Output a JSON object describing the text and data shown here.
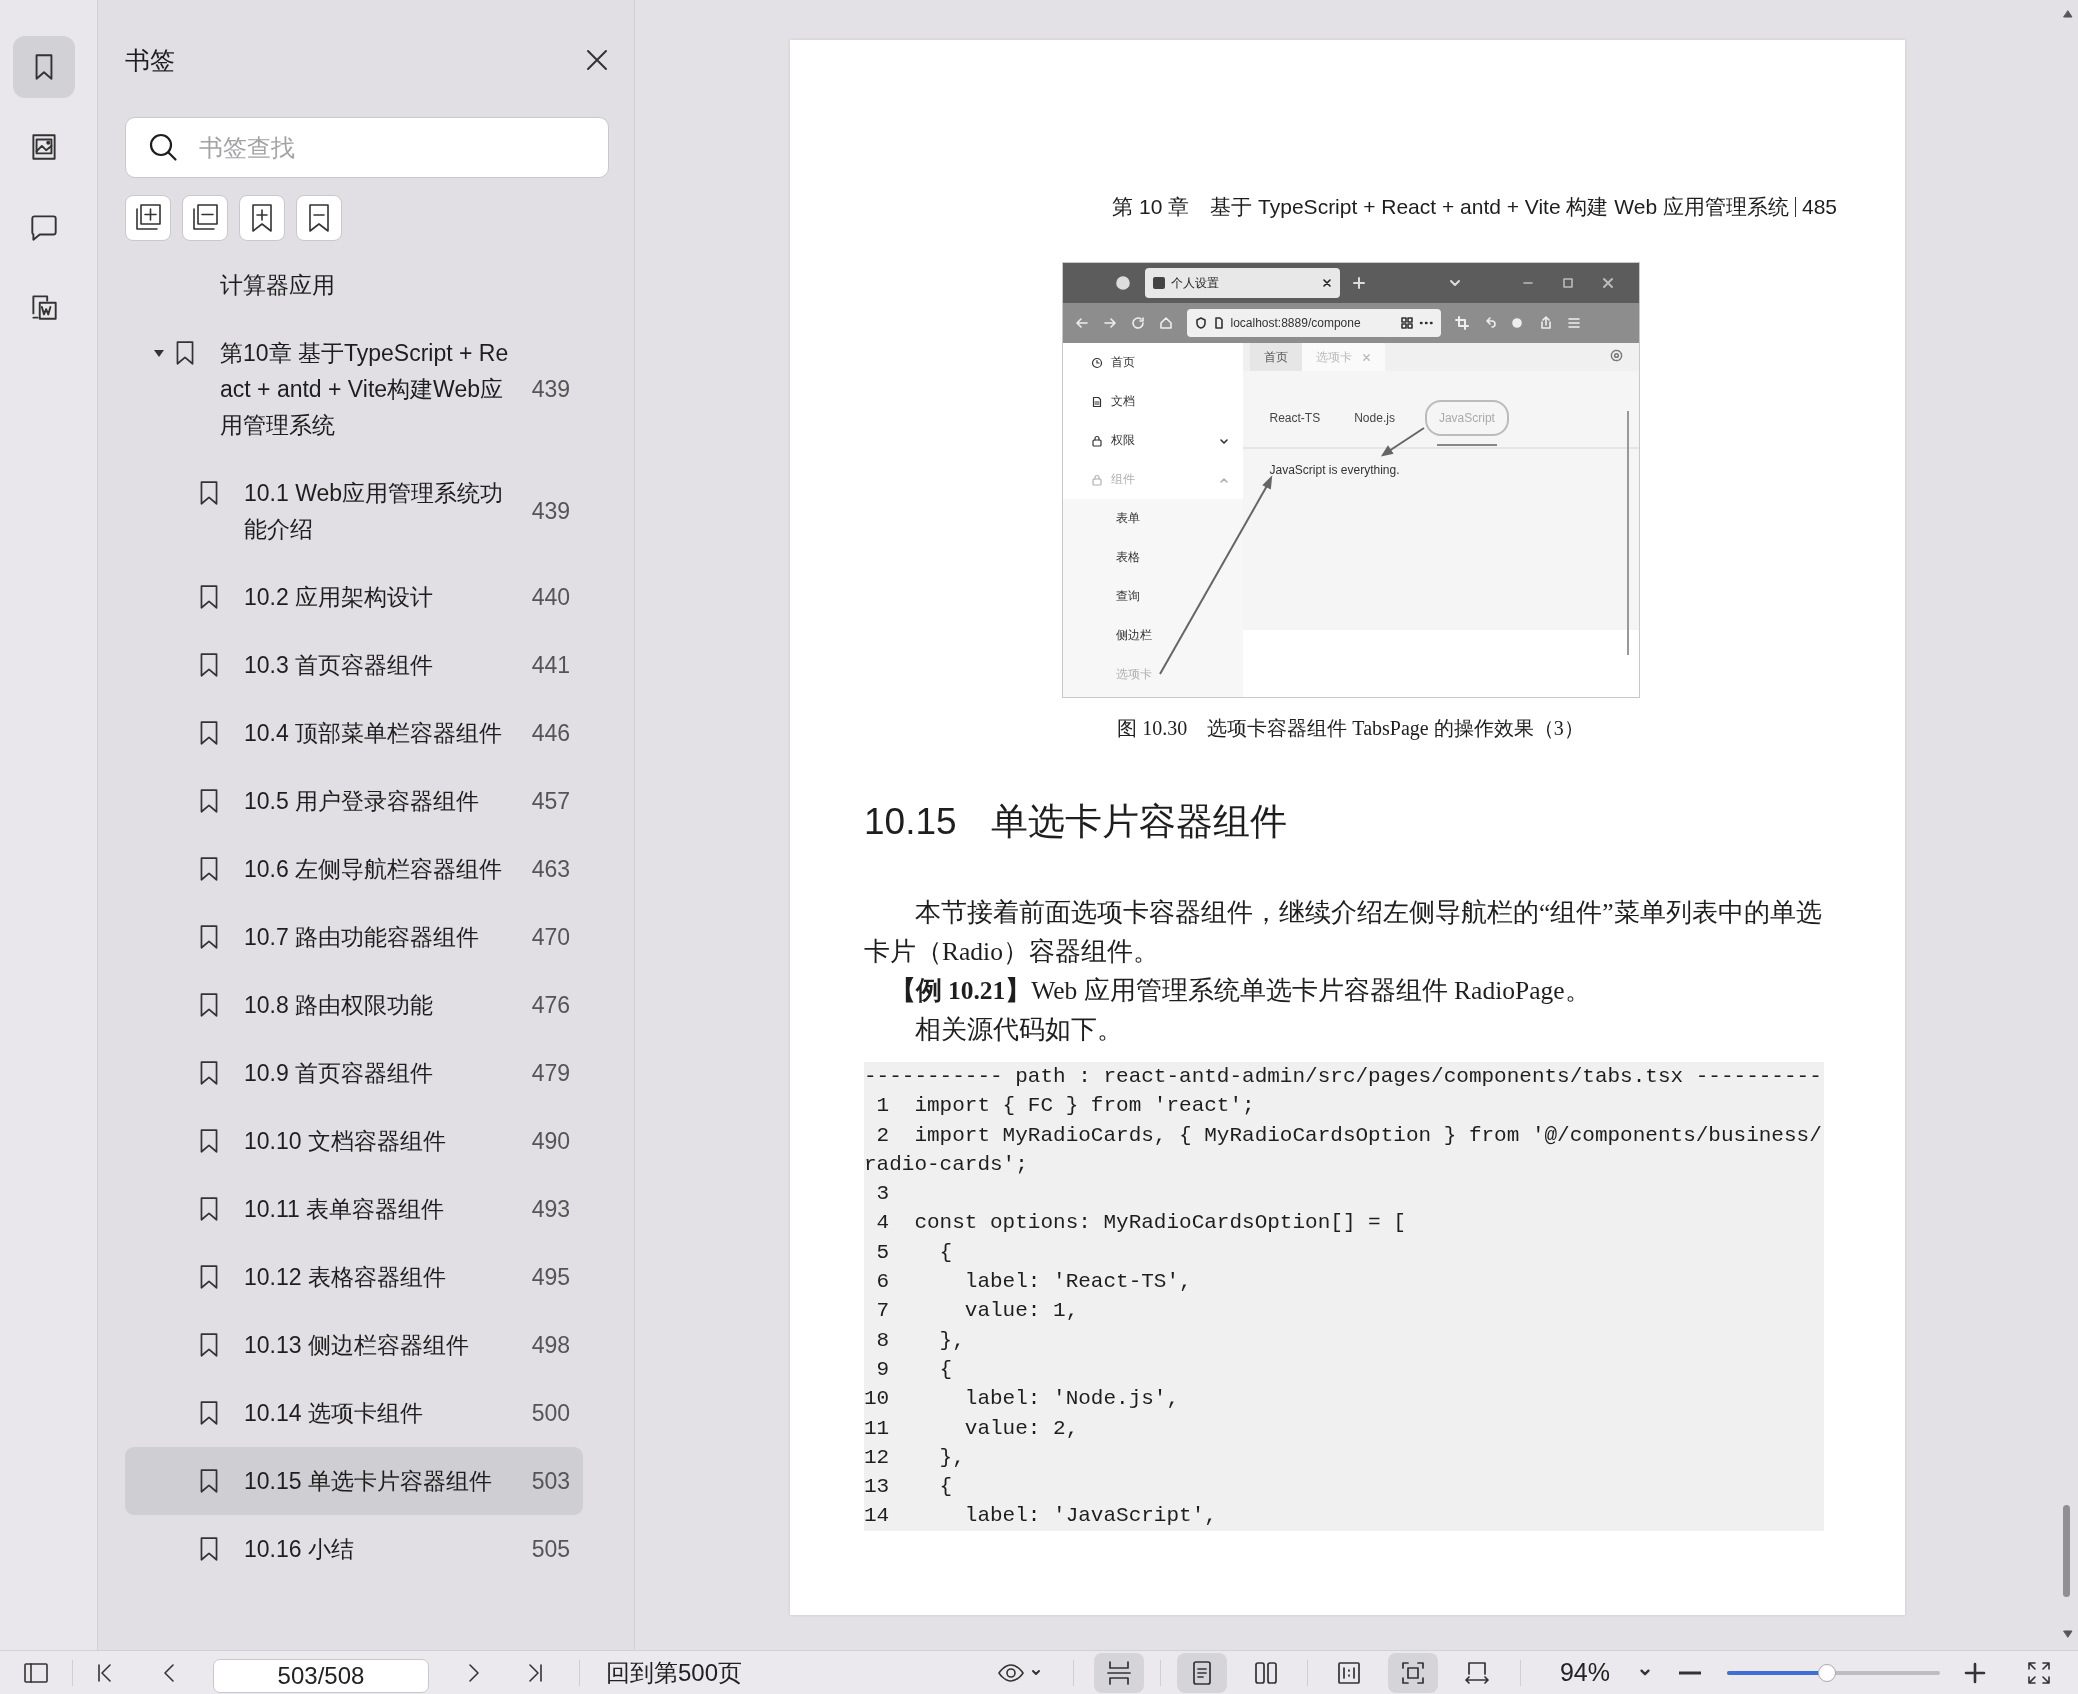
{
  "rail": [
    {
      "kind": "bookmarks",
      "selected": true
    },
    {
      "kind": "images",
      "selected": false
    },
    {
      "kind": "comments",
      "selected": false
    },
    {
      "kind": "convert",
      "selected": false
    }
  ],
  "bookmarks_panel": {
    "title": "书签",
    "search": {
      "placeholder": "书签查找"
    },
    "items": [
      {
        "kind": "fragment",
        "title": "计算器应用",
        "selected": false
      },
      {
        "kind": "item",
        "title": "第10章 基于TypeScript + React + antd + Vite构建Web应用管理系统",
        "page": "439",
        "selected": false,
        "expanded": true,
        "children": [
          {
            "kind": "item",
            "title": "10.1 Web应用管理系统功能介绍",
            "page": "439",
            "selected": false
          },
          {
            "kind": "item",
            "title": "10.2 应用架构设计",
            "page": "440",
            "selected": false
          },
          {
            "kind": "item",
            "title": "10.3 首页容器组件",
            "page": "441",
            "selected": false
          },
          {
            "kind": "item",
            "title": "10.4 顶部菜单栏容器组件",
            "page": "446",
            "selected": false
          },
          {
            "kind": "item",
            "title": "10.5 用户登录容器组件",
            "page": "457",
            "selected": false
          },
          {
            "kind": "item",
            "title": "10.6 左侧导航栏容器组件",
            "page": "463",
            "selected": false
          },
          {
            "kind": "item",
            "title": "10.7 路由功能容器组件",
            "page": "470",
            "selected": false
          },
          {
            "kind": "item",
            "title": "10.8 路由权限功能",
            "page": "476",
            "selected": false
          },
          {
            "kind": "item",
            "title": "10.9 首页容器组件",
            "page": "479",
            "selected": false
          },
          {
            "kind": "item",
            "title": "10.10 文档容器组件",
            "page": "490",
            "selected": false
          },
          {
            "kind": "item",
            "title": "10.11 表单容器组件",
            "page": "493",
            "selected": false
          },
          {
            "kind": "item",
            "title": "10.12 表格容器组件",
            "page": "495",
            "selected": false
          },
          {
            "kind": "item",
            "title": "10.13 侧边栏容器组件",
            "page": "498",
            "selected": false
          },
          {
            "kind": "item",
            "title": "10.14 选项卡组件",
            "page": "500",
            "selected": false
          },
          {
            "kind": "item",
            "title": "10.15 单选卡片容器组件",
            "page": "503",
            "selected": true
          },
          {
            "kind": "item",
            "title": "10.16 小结",
            "page": "505",
            "selected": false
          }
        ]
      }
    ]
  },
  "document": {
    "header": "第 10 章　基于 TypeScript + React + antd + Vite 构建 Web 应用管理系统",
    "page_number": "485",
    "figure": {
      "tab_title": "个人设置",
      "url": "localhost:8889/compone",
      "menu": [
        {
          "label": "首页",
          "kind": "item",
          "selected": false
        },
        {
          "label": "文档",
          "kind": "item",
          "selected": false
        },
        {
          "label": "权限",
          "kind": "group",
          "expanded": false,
          "selected": false
        },
        {
          "label": "组件",
          "kind": "group",
          "expanded": true,
          "selected": true
        }
      ],
      "submenu": [
        {
          "label": "表单",
          "selected": false
        },
        {
          "label": "表格",
          "selected": false
        },
        {
          "label": "查询",
          "selected": false
        },
        {
          "label": "侧边栏",
          "selected": false
        },
        {
          "label": "选项卡",
          "selected": true
        }
      ],
      "page_tabs": [
        {
          "label": "首页",
          "selected": false
        },
        {
          "label": "选项卡",
          "selected": true
        }
      ],
      "radio_tabs": [
        {
          "label": "React-TS",
          "selected": false
        },
        {
          "label": "Node.js",
          "selected": false
        },
        {
          "label": "JavaScript",
          "selected": true
        }
      ],
      "content": "JavaScript is everything."
    },
    "caption": "图 10.30　选项卡容器组件 TabsPage 的操作效果（3）",
    "heading_number": "10.15",
    "heading": "单选卡片容器组件",
    "paragraphs": [
      {
        "kind": "body",
        "text": "本节接着前面选项卡容器组件，继续介绍左侧导航栏的“组件”菜单列表中的单选卡片（Radio）容器组件。"
      },
      {
        "kind": "example",
        "text": "**【例 10.21】**Web 应用管理系统单选卡片容器组件 RadioPage。"
      },
      {
        "kind": "body",
        "text": "相关源代码如下。"
      }
    ],
    "code": {
      "header": "----------- path : react-antd-admin/src/pages/components/tabs.tsx ----------",
      "lines": [
        {
          "number": "1",
          "code": "import { FC } from 'react';"
        },
        {
          "number": "2",
          "code": "import MyRadioCards, { MyRadioCardsOption } from '@/components/business/radio-cards';"
        },
        {
          "number": "3"
        },
        {
          "number": "4",
          "code": "const options: MyRadioCardsOption[] = ["
        },
        {
          "number": "5",
          "code": "  {"
        },
        {
          "number": "6",
          "code": "    label: 'React-TS',"
        },
        {
          "number": "7",
          "code": "    value: 1,"
        },
        {
          "number": "8",
          "code": "  },"
        },
        {
          "number": "9",
          "code": "  {"
        },
        {
          "number": "10",
          "code": "    label: 'Node.js',"
        },
        {
          "number": "11",
          "code": "    value: 2,"
        },
        {
          "number": "12",
          "code": "  },"
        },
        {
          "number": "13",
          "code": "  {"
        },
        {
          "number": "14",
          "code": "    label: 'JavaScript',"
        }
      ]
    }
  },
  "toolbar": {
    "page_field": "503/508",
    "back_link": "回到第500页",
    "view_buttons": [
      {
        "kind": "continuous",
        "selected": true
      },
      {
        "kind": "single",
        "selected": true
      },
      {
        "kind": "two-page",
        "selected": false
      },
      {
        "kind": "fit-page",
        "selected": false
      },
      {
        "kind": "actual-size",
        "selected": true
      },
      {
        "kind": "fit-width",
        "selected": false
      }
    ],
    "zoom": "94%",
    "zoom_slider": {
      "level": 0.47
    }
  }
}
